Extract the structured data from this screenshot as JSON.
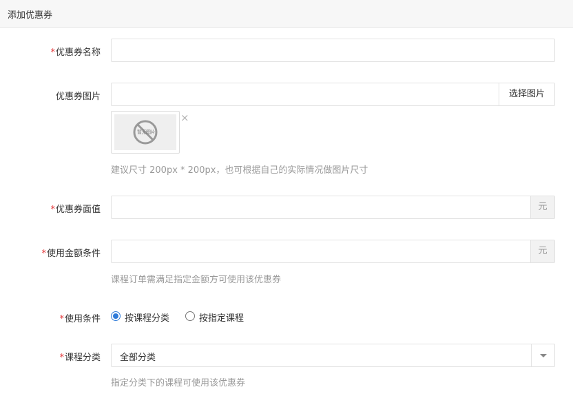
{
  "header": {
    "title": "添加优惠券"
  },
  "fields": {
    "coupon_name": {
      "required_mark": "*",
      "label": "优惠券名称",
      "value": "",
      "placeholder": ""
    },
    "coupon_image": {
      "label": "优惠券图片",
      "value": "",
      "button_label": "选择图片",
      "thumb_text": "暂无图片",
      "remove_icon": "×",
      "hint": "建议尺寸 200px * 200px，也可根据自己的实际情况做图片尺寸"
    },
    "face_value": {
      "required_mark": "*",
      "label": "优惠券面值",
      "value": "",
      "unit": "元"
    },
    "min_amount": {
      "required_mark": "*",
      "label": "使用金额条件",
      "value": "",
      "unit": "元",
      "hint": "课程订单需满足指定金额方可使用该优惠券"
    },
    "use_condition": {
      "required_mark": "*",
      "label": "使用条件",
      "options": [
        {
          "label": "按课程分类",
          "checked": true
        },
        {
          "label": "按指定课程",
          "checked": false
        }
      ]
    },
    "course_category": {
      "required_mark": "*",
      "label": "课程分类",
      "selected": "全部分类",
      "hint": "指定分类下的课程可使用该优惠券"
    }
  },
  "colors": {
    "accent": "#2f7bd9",
    "required": "#e4393c",
    "hint": "#999999"
  }
}
